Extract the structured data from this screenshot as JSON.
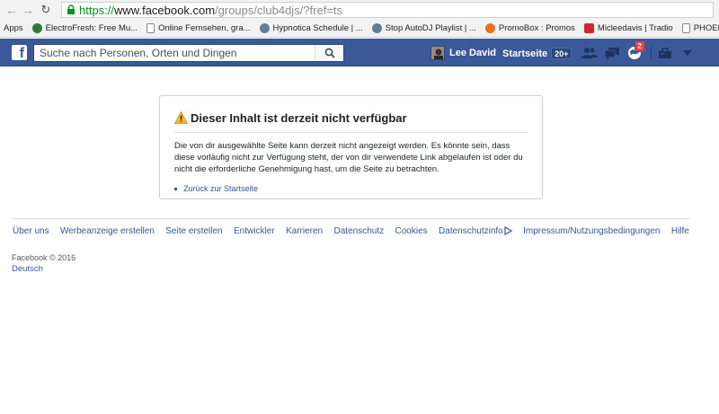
{
  "browser": {
    "url_scheme": "https://",
    "url_host": "www.facebook.com",
    "url_path": "/groups/club4djs/?fref=ts"
  },
  "bookmarks": [
    {
      "label": "Apps",
      "icon": "apps-grid-icon",
      "color": "#4285f4"
    },
    {
      "label": "ElectroFresh: Free Mu...",
      "icon": "electrofresh-favicon",
      "color": "#2d7a3a"
    },
    {
      "label": "Online Fernsehen, gra...",
      "icon": "page-icon",
      "color": "#ffffff"
    },
    {
      "label": "Hypnotica Schedule | ...",
      "icon": "hypnotica-favicon",
      "color": "#5f7f8f"
    },
    {
      "label": "Stop AutoDJ Playlist | ...",
      "icon": "autodj-favicon",
      "color": "#5f7f8f"
    },
    {
      "label": "PromoBox : Promos",
      "icon": "promobox-favicon",
      "color": "#e8731f"
    },
    {
      "label": "Micleedavis | Tradio",
      "icon": "tradio-favicon",
      "color": "#d0282e"
    },
    {
      "label": "PHOENIX Live Stream ...",
      "icon": "page-icon",
      "color": "#ffffff"
    }
  ],
  "fb": {
    "search_placeholder": "Suche nach Personen, Orten und Dingen",
    "user_name": "Lee David",
    "home_label": "Startseite",
    "home_count": "20+",
    "notifications_count": "2"
  },
  "error": {
    "title": "Dieser Inhalt ist derzeit nicht verfügbar",
    "line1": "Die von dir ausgewählte Seite kann derzeit nicht angezeigt werden. Es könnte sein, dass",
    "line2": "diese vorläufig nicht zur Verfügung steht, der von dir verwendete Link abgelaufen ist oder du",
    "line3": "nicht die erforderliche Genehmigung hast, um die Seite zu betrachten.",
    "link": "Zurück zur Startseite"
  },
  "footer": {
    "links": [
      "Über uns",
      "Werbeanzeige erstellen",
      "Seite erstellen",
      "Entwickler",
      "Karrieren",
      "Datenschutz",
      "Cookies",
      "Datenschutzinfo",
      "Impressum/Nutzungsbedingungen",
      "Hilfe"
    ],
    "copyright": "Facebook © 2016",
    "language": "Deutsch"
  },
  "colors": {
    "fb_blue": "#3b5998",
    "link_blue": "#365899",
    "warning_yellow": "#f7b928",
    "notification_red": "#fa3e3e",
    "url_green": "#0b8f20"
  }
}
